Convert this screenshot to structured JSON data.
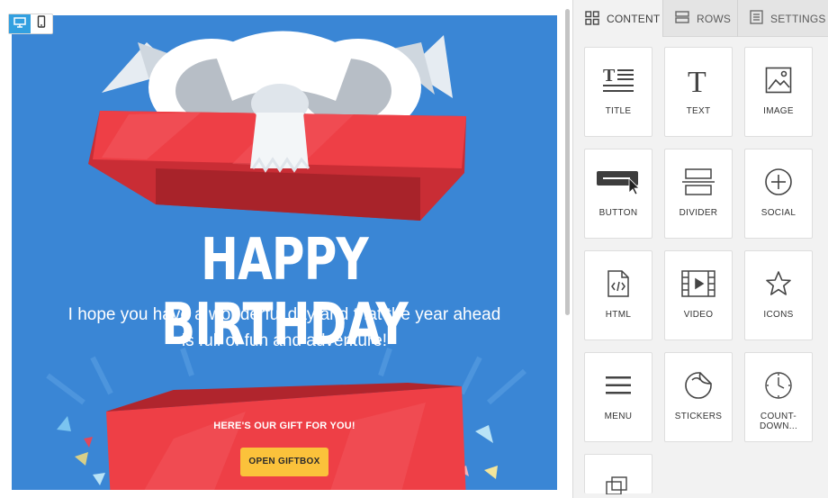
{
  "email": {
    "headline": "HAPPY BIRTHDAY",
    "subline_1": "I hope you have a wonderful day and that the year ahead",
    "subline_2": "is full of fun and adventure!",
    "gift_caption": "HERE'S OUR GIFT FOR YOU!",
    "gift_button": "OPEN GIFTBOX",
    "background_color": "#3a86d5",
    "accent_red": "#e8383f",
    "button_color": "#fbc23b"
  },
  "device_toggle": {
    "desktop_icon": "desktop-icon",
    "mobile_icon": "mobile-icon",
    "active": "desktop"
  },
  "panel": {
    "tabs": [
      {
        "label": "CONTENT",
        "icon": "grid-icon",
        "active": true
      },
      {
        "label": "ROWS",
        "icon": "rows-icon",
        "active": false
      },
      {
        "label": "SETTINGS",
        "icon": "settings-doc-icon",
        "active": false
      }
    ],
    "tiles": [
      {
        "label": "TITLE",
        "icon": "title-icon"
      },
      {
        "label": "TEXT",
        "icon": "text-icon"
      },
      {
        "label": "IMAGE",
        "icon": "image-icon"
      },
      {
        "label": "BUTTON",
        "icon": "button-icon"
      },
      {
        "label": "DIVIDER",
        "icon": "divider-icon"
      },
      {
        "label": "SOCIAL",
        "icon": "social-plus-icon"
      },
      {
        "label": "HTML",
        "icon": "html-file-icon"
      },
      {
        "label": "VIDEO",
        "icon": "video-icon"
      },
      {
        "label": "ICONS",
        "icon": "star-icon"
      },
      {
        "label": "MENU",
        "icon": "menu-icon"
      },
      {
        "label": "STICKERS",
        "icon": "sticker-icon"
      },
      {
        "label": "COUNT-DOWN...",
        "icon": "clock-icon"
      },
      {
        "label": "",
        "icon": "copy-icon"
      }
    ]
  }
}
